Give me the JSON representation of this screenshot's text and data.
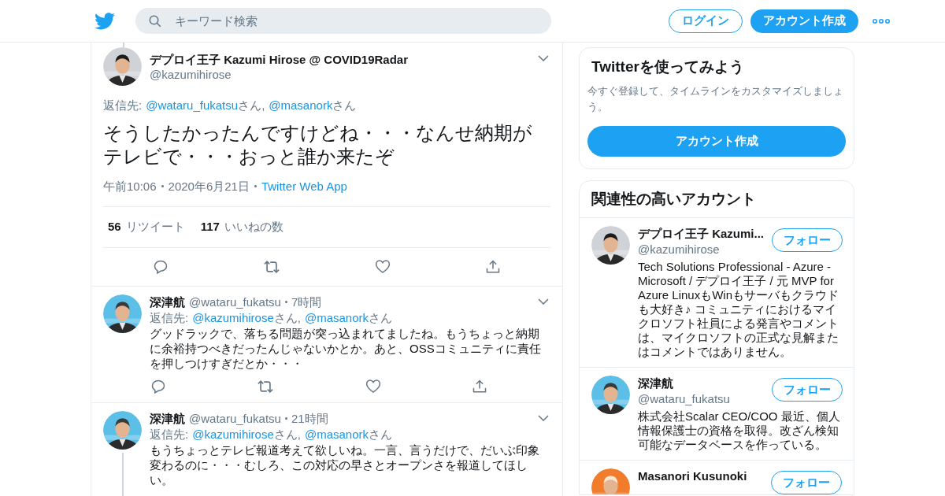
{
  "header": {
    "search_placeholder": "キーワード検索",
    "login": "ログイン",
    "signup": "アカウント作成"
  },
  "main_tweet": {
    "name": "デプロイ王子 Kazumi Hirose @ COVID19Radar",
    "handle": "@kazumihirose",
    "reply_label": "返信先:",
    "reply_to": [
      {
        "handle": "@wataru_fukatsu",
        "suffix": "さん,"
      },
      {
        "handle": "@masanork",
        "suffix": "さん"
      }
    ],
    "text": "そうしたかったんですけどね・・・なんせ納期がテレビで・・・おっと誰か来たぞ",
    "time": "午前10:06",
    "date": "2020年6月21日",
    "source": "Twitter Web App",
    "retweets": {
      "count": "56",
      "label": "リツイート"
    },
    "likes": {
      "count": "117",
      "label": "いいねの数"
    }
  },
  "replies": [
    {
      "name": "深津航",
      "handle": "@wataru_fukatsu",
      "time": "7時間",
      "reply_label": "返信先:",
      "reply_to": [
        {
          "handle": "@kazumihirose",
          "suffix": "さん,"
        },
        {
          "handle": "@masanork",
          "suffix": "さん"
        }
      ],
      "text": "グッドラックで、落ちる問題が突っ込まれてましたね。もうちょっと納期に余裕持つべきだったんじゃないかとか。あと、OSSコミュニティに責任を押しつけすぎだとか・・・",
      "thread": false
    },
    {
      "name": "深津航",
      "handle": "@wataru_fukatsu",
      "time": "21時間",
      "reply_label": "返信先:",
      "reply_to": [
        {
          "handle": "@kazumihirose",
          "suffix": "さん,"
        },
        {
          "handle": "@masanork",
          "suffix": "さん"
        }
      ],
      "text": "もうちょっとテレビ報道考えて欲しいね。一言、言うだけで、だいぶ印象変わるのに・・・むしろ、この対応の早さとオープンさを報道してほしい。",
      "thread": true
    }
  ],
  "signup_card": {
    "title": "Twitterを使ってみよう",
    "text": "今すぐ登録して、タイムラインをカスタマイズしましょう。",
    "button": "アカウント作成"
  },
  "related": {
    "title": "関連性の高いアカウント",
    "accounts": [
      {
        "name": "デプロイ王子 Kazumi...",
        "handle": "@kazumihirose",
        "follow": "フォロー",
        "bio": "Tech Solutions Professional - Azure - Microsoft / デプロイ王子 / 元 MVP for Azure LinuxもWinもサーバもクラウドも大好き♪ コミュニティにおけるマイクロソフト社員による発言やコメントは、マイクロソフトの正式な見解またはコメントではありません。"
      },
      {
        "name": "深津航",
        "handle": "@wataru_fukatsu",
        "follow": "フォロー",
        "bio": "株式会社Scalar CEO/COO 最近、個人情報保護士の資格を取得。改ざん検知可能なデータベースを作っている。"
      },
      {
        "name": "Masanori Kusunoki",
        "follow": "フォロー"
      }
    ]
  }
}
